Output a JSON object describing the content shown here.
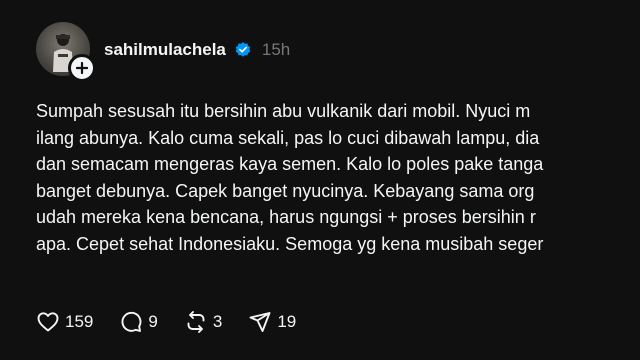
{
  "post": {
    "author": {
      "username": "sahilmulachela",
      "verified": true,
      "avatar_icon": "profile-photo",
      "follow_icon": "plus-icon"
    },
    "time_ago": "15h",
    "text_lines": [
      "Sumpah sesusah itu bersihin abu vulkanik dari mobil. Nyuci m",
      "ilang abunya. Kalo cuma sekali, pas lo cuci dibawah lampu, dia",
      "dan semacam mengeras kaya semen. Kalo lo poles pake tanga",
      "banget debunya. Capek banget nyucinya. Kebayang sama org",
      "udah mereka kena bencana, harus ngungsi + proses bersihin r",
      "apa. Cepet sehat Indonesiaku. Semoga yg kena musibah seger"
    ],
    "actions": {
      "likes": "159",
      "replies": "9",
      "reposts": "3",
      "shares": "19"
    }
  },
  "colors": {
    "background": "#101010",
    "text": "#f3f5f7",
    "muted": "#777777",
    "verified": "#0095f6"
  }
}
